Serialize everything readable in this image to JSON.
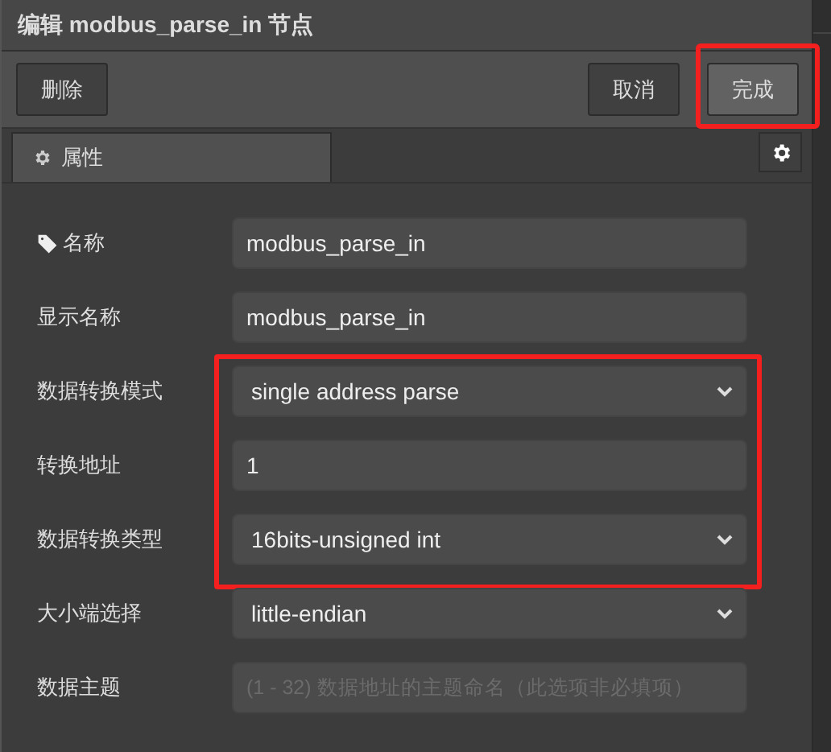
{
  "window": {
    "title": "编辑 modbus_parse_in 节点"
  },
  "toolbar": {
    "left_buttons": [
      {
        "label": "删除",
        "primary": false,
        "highlighted": false
      }
    ],
    "right_buttons": [
      {
        "label": "取消",
        "primary": false,
        "highlighted": false
      },
      {
        "label": "完成",
        "primary": true,
        "highlighted": true
      }
    ]
  },
  "tabs": [
    {
      "label": "属性",
      "selected": true
    }
  ],
  "form": {
    "sections": [
      {
        "highlighted": false,
        "rows": [
          {
            "label": "名称",
            "kind": "text",
            "value": "modbus_parse_in"
          },
          {
            "label": "显示名称",
            "kind": "text",
            "value": "modbus_parse_in"
          }
        ]
      },
      {
        "highlighted": true,
        "rows": [
          {
            "label": "数据转换模式",
            "kind": "select",
            "value": "single address parse"
          },
          {
            "label": "转换地址",
            "kind": "text",
            "value": "1"
          },
          {
            "label": "数据转换类型",
            "kind": "select",
            "value": "16bits-unsigned int"
          }
        ]
      },
      {
        "highlighted": false,
        "rows": [
          {
            "label": "大小端选择",
            "kind": "select",
            "value": "little-endian"
          },
          {
            "label": "数据主题",
            "kind": "text",
            "placeholder": "(1 - 32) 数据地址的主题命名（此选项非必填项）"
          }
        ]
      }
    ]
  }
}
